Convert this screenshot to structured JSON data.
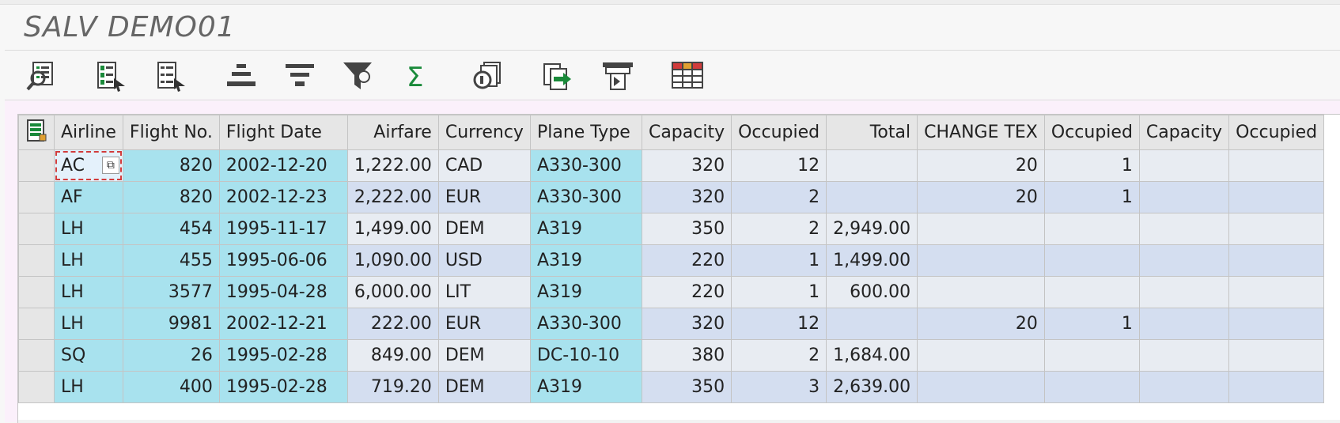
{
  "title": "SALV DEMO01",
  "toolbar": {
    "buttons": [
      {
        "name": "details",
        "icon": "details-icon"
      },
      {
        "name": "sort-ascending",
        "icon": "sort-ascending-icon"
      },
      {
        "name": "sort-descending",
        "icon": "sort-descending-icon"
      },
      {
        "name": "center",
        "icon": "align-center-icon"
      },
      {
        "name": "filter-list",
        "icon": "filter-list-icon"
      },
      {
        "name": "filter",
        "icon": "filter-funnel-icon"
      },
      {
        "name": "sum",
        "icon": "sum-icon"
      },
      {
        "name": "print-preview",
        "icon": "print-preview-icon"
      },
      {
        "name": "export",
        "icon": "export-icon"
      },
      {
        "name": "print",
        "icon": "print-icon"
      },
      {
        "name": "layout",
        "icon": "layout-grid-icon"
      }
    ]
  },
  "grid": {
    "columns": [
      {
        "label": "Airline",
        "align": "left"
      },
      {
        "label": "Flight No.",
        "align": "right"
      },
      {
        "label": "Flight Date",
        "align": "left"
      },
      {
        "label": "Airfare",
        "align": "right"
      },
      {
        "label": "Currency",
        "align": "left"
      },
      {
        "label": "Plane Type",
        "align": "left"
      },
      {
        "label": "Capacity",
        "align": "right"
      },
      {
        "label": "Occupied",
        "align": "right"
      },
      {
        "label": "Total",
        "align": "right"
      },
      {
        "label": "CHANGE TEX",
        "align": "right"
      },
      {
        "label": "Occupied",
        "align": "right"
      },
      {
        "label": "Capacity",
        "align": "right"
      },
      {
        "label": "Occupied",
        "align": "right"
      }
    ],
    "rows": [
      [
        "AC",
        "820",
        "2002-12-20",
        "1,222.00",
        "CAD",
        "A330-300",
        "320",
        "12",
        "",
        "20",
        "1",
        "",
        ""
      ],
      [
        "AF",
        "820",
        "2002-12-23",
        "2,222.00",
        "EUR",
        "A330-300",
        "320",
        "2",
        "",
        "20",
        "1",
        "",
        ""
      ],
      [
        "LH",
        "454",
        "1995-11-17",
        "1,499.00",
        "DEM",
        "A319",
        "350",
        "2",
        "2,949.00",
        "",
        "",
        "",
        ""
      ],
      [
        "LH",
        "455",
        "1995-06-06",
        "1,090.00",
        "USD",
        "A319",
        "220",
        "1",
        "1,499.00",
        "",
        "",
        "",
        ""
      ],
      [
        "LH",
        "3577",
        "1995-04-28",
        "6,000.00",
        "LIT",
        "A319",
        "220",
        "1",
        "600.00",
        "",
        "",
        "",
        ""
      ],
      [
        "LH",
        "9981",
        "2002-12-21",
        "222.00",
        "EUR",
        "A330-300",
        "320",
        "12",
        "",
        "20",
        "1",
        "",
        ""
      ],
      [
        "SQ",
        "26",
        "1995-02-28",
        "849.00",
        "DEM",
        "DC-10-10",
        "380",
        "2",
        "1,684.00",
        "",
        "",
        "",
        ""
      ],
      [
        "LH",
        "400",
        "1995-02-28",
        "719.20",
        "DEM",
        "A319",
        "350",
        "3",
        "2,639.00",
        "",
        "",
        "",
        ""
      ]
    ],
    "focused_cell": {
      "row": 0,
      "col": 0
    },
    "key_columns": [
      0,
      1,
      2,
      5
    ]
  },
  "colors": {
    "key_cell": "#a8e2ee",
    "row_odd": "#e8ecf2",
    "row_even": "#d4def0",
    "header": "#e6e6e6",
    "focus_border": "#d23c3c",
    "sum_icon": "#1a8a3a"
  }
}
